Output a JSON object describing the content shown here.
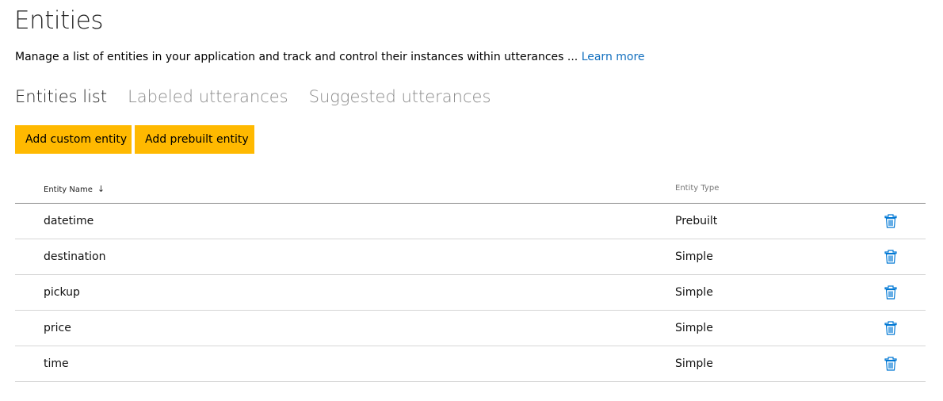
{
  "page": {
    "title": "Entities",
    "description": "Manage a list of entities in your application and track and control their instances within utterances ...",
    "learn_more": "Learn more"
  },
  "tabs": [
    {
      "label": "Entities list",
      "active": true
    },
    {
      "label": "Labeled utterances",
      "active": false
    },
    {
      "label": "Suggested utterances",
      "active": false
    }
  ],
  "toolbar": {
    "add_custom_label": "Add custom entity",
    "add_prebuilt_label": "Add prebuilt entity"
  },
  "table": {
    "columns": {
      "name": "Entity Name",
      "type": "Entity Type",
      "sort_icon": "arrow-down-icon"
    },
    "rows": [
      {
        "name": "datetime",
        "type": "Prebuilt",
        "action_icon": "trash-icon"
      },
      {
        "name": "destination",
        "type": "Simple",
        "action_icon": "trash-icon"
      },
      {
        "name": "pickup",
        "type": "Simple",
        "action_icon": "trash-icon"
      },
      {
        "name": "price",
        "type": "Simple",
        "action_icon": "trash-icon"
      },
      {
        "name": "time",
        "type": "Simple",
        "action_icon": "trash-icon"
      }
    ]
  },
  "colors": {
    "accent_button": "#ffb900",
    "link": "#106ebe",
    "icon": "#0078d4"
  }
}
